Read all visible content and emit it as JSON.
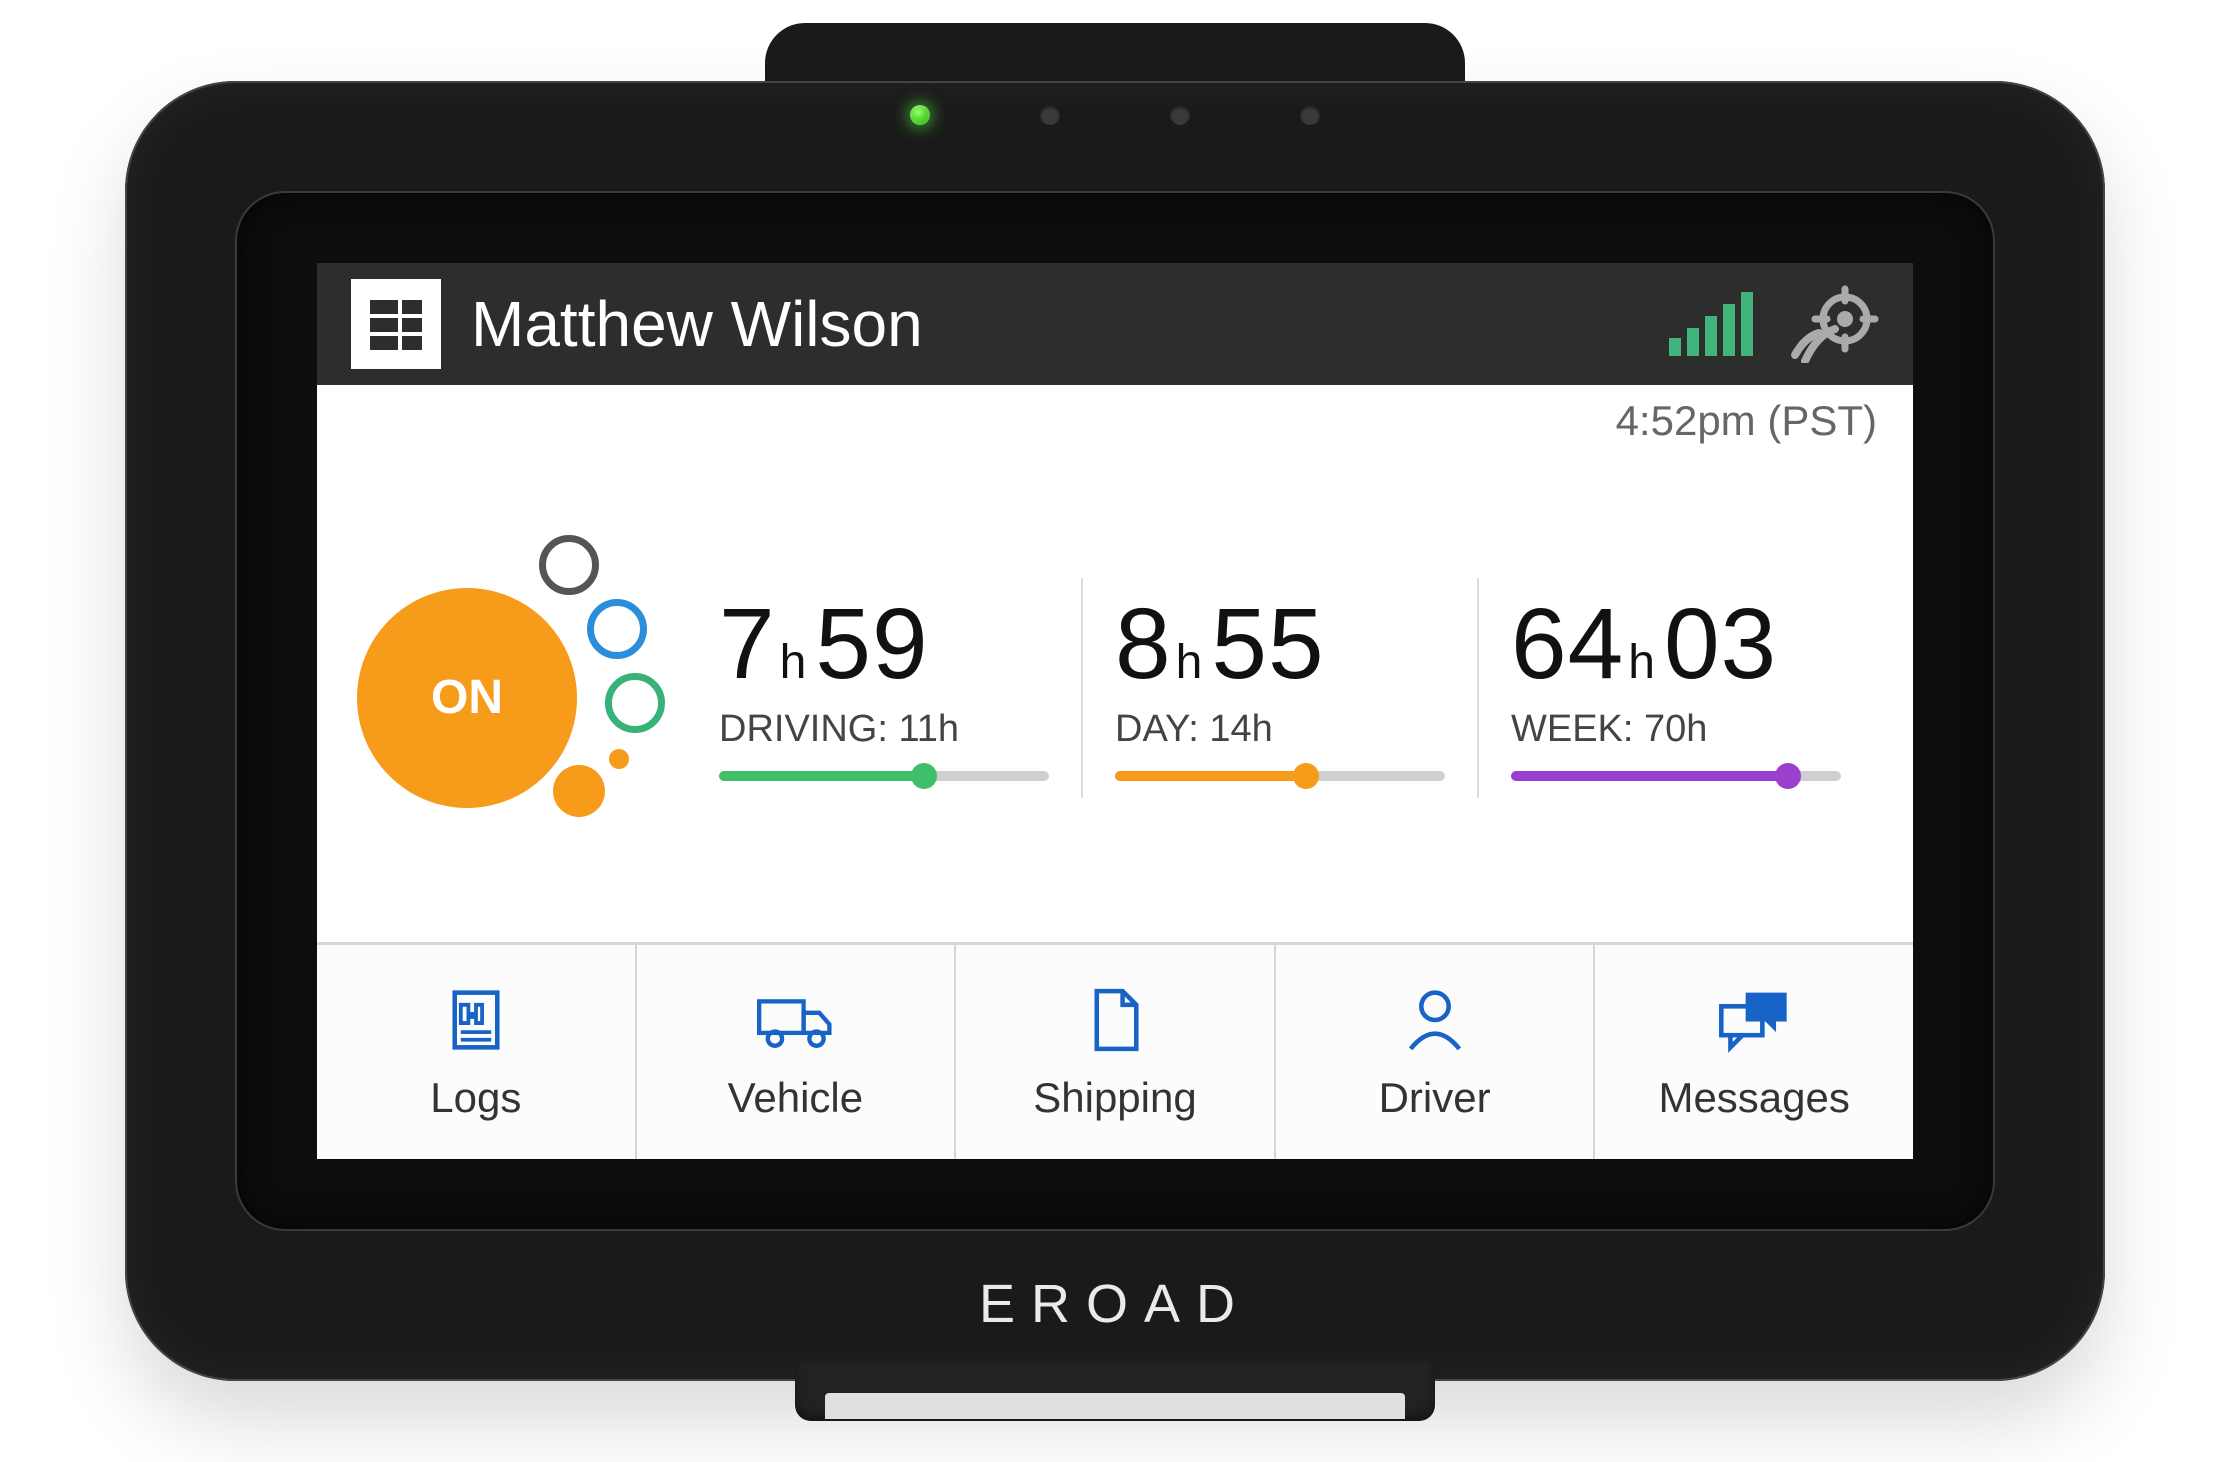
{
  "header": {
    "username": "Matthew Wilson"
  },
  "time": "4:52pm (PST)",
  "status": {
    "label": "ON"
  },
  "brand": "EROAD",
  "timers": [
    {
      "big": "7",
      "h": "h",
      "small": "59",
      "label": "DRIVING: 11h",
      "pct": 62,
      "color": "#3fbf6a"
    },
    {
      "big": "8",
      "h": "h",
      "small": "55",
      "label": "DAY: 14h",
      "pct": 58,
      "color": "#f79b1a"
    },
    {
      "big": "64",
      "h": "h",
      "small": "03",
      "label": "WEEK: 70h",
      "pct": 84,
      "color": "#9b3fcf"
    }
  ],
  "nav": [
    {
      "label": "Logs"
    },
    {
      "label": "Vehicle"
    },
    {
      "label": "Shipping"
    },
    {
      "label": "Driver"
    },
    {
      "label": "Messages"
    }
  ]
}
